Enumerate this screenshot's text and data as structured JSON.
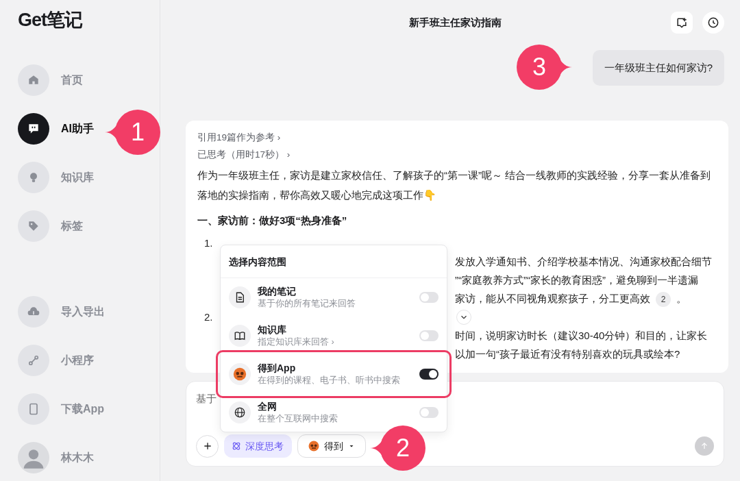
{
  "app": {
    "logo": "Get笔记"
  },
  "sidebar": {
    "items": [
      {
        "label": "首页",
        "selected": false
      },
      {
        "label": "AI助手",
        "selected": true,
        "callout": "1"
      },
      {
        "label": "知识库",
        "selected": false
      },
      {
        "label": "标签",
        "selected": false
      }
    ],
    "bottom_items": [
      {
        "label": "导入导出"
      },
      {
        "label": "小程序"
      },
      {
        "label": "下载App"
      }
    ],
    "user": {
      "name": "林木木"
    }
  },
  "header": {
    "title": "新手班主任家访指南"
  },
  "question": {
    "text": "一年级班主任如何家访?",
    "callout": "3"
  },
  "answer": {
    "references": "引用19篇作为参考 ›",
    "thinking": "已思考（用时17秒） ›",
    "intro": "作为一年级班主任，家访是建立家校信任、了解孩子的“第一课”呢～ 结合一线教师的实践经验，分享一套从准备到落地的实操指南，帮你高效又暖心地完成这项工作👇",
    "heading": "一、家访前：做好3项“热身准备”",
    "lines": [
      {
        "number": "1."
      },
      {
        "text": "发放入学通知书、介绍学校基本情况、沟通家校配合细节"
      },
      {
        "text": "”“家庭教养方式”“家长的教育困惑”，避免聊到一半遗漏"
      },
      {
        "text": "家访，能从不同视角观察孩子，分工更高效",
        "cite": "2",
        "tail": "。"
      },
      {
        "number": "2."
      },
      {
        "text": "时间，说明家访时长（建议30-40分钟）和目的，让家长"
      },
      {
        "text": "以加一句“孩子最近有没有特别喜欢的玩具或绘本?"
      }
    ]
  },
  "composer": {
    "placeholder": "基于",
    "deep_think": {
      "label": "深度思考",
      "on": true
    },
    "source": {
      "label": "得到"
    },
    "callout": "2",
    "scope_menu": {
      "title": "选择内容范围",
      "options": [
        {
          "title": "我的笔记",
          "subtitle": "基于你的所有笔记来回答",
          "on": false,
          "highlighted": false
        },
        {
          "title": "知识库",
          "subtitle": "指定知识库来回答 ›",
          "on": false,
          "highlighted": false
        },
        {
          "title": "得到App",
          "subtitle": "在得到的课程、电子书、听书中搜索",
          "on": true,
          "highlighted": true
        },
        {
          "title": "全网",
          "subtitle": "在整个互联网中搜索",
          "on": false,
          "highlighted": false
        }
      ]
    }
  }
}
